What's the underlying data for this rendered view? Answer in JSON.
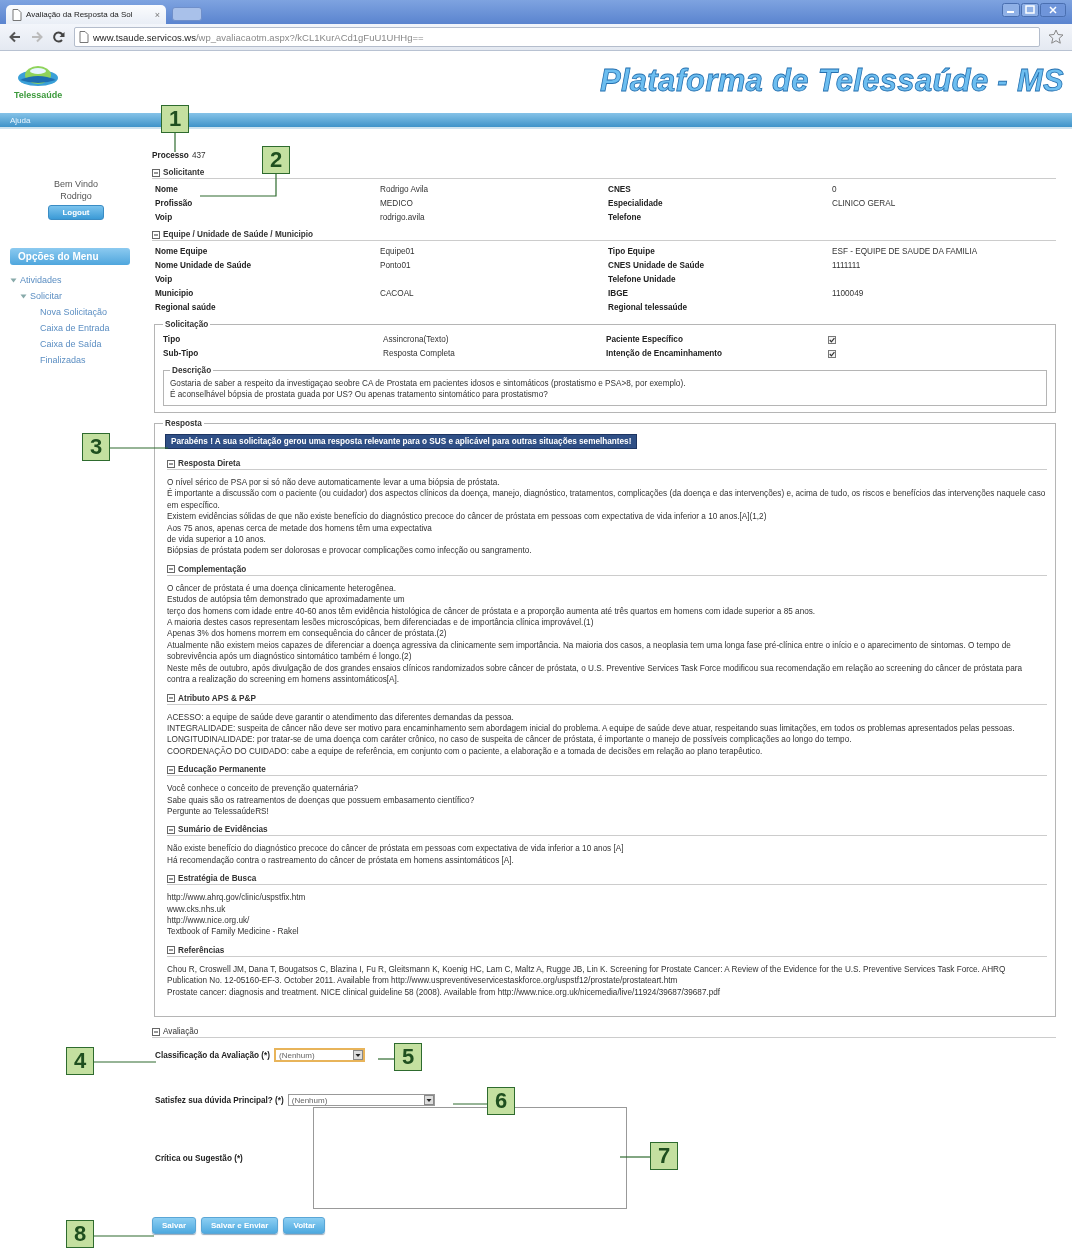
{
  "browser": {
    "tab_title": "Avaliação da Resposta da Sol",
    "tab_close": "×",
    "url_host": "www.tsaude.servicos.ws",
    "url_path": "/wp_avaliacaotm.aspx?/kCL1KurACd1gFuU1UHHg=="
  },
  "header": {
    "logo_text": "Telessaúde",
    "title": "Plataforma de Telessaúde - MS"
  },
  "menu_bar": {
    "label": "Ajuda"
  },
  "sidebar": {
    "welcome": "Bem Vindo",
    "user": "Rodrigo",
    "logout": "Logout",
    "menu_title": "Opções do Menu",
    "tree": [
      {
        "label": "Atividades",
        "expanded": true,
        "children": [
          {
            "label": "Solicitar",
            "expanded": true,
            "children": [
              {
                "label": "Nova Solicitação"
              },
              {
                "label": "Caixa de Entrada"
              },
              {
                "label": "Caixa de Saída"
              },
              {
                "label": "Finalizadas"
              }
            ]
          }
        ]
      }
    ]
  },
  "process": {
    "label": "Processo",
    "value": "437"
  },
  "sections": [
    {
      "title": "Solicitante",
      "expanded": true,
      "fields": [
        {
          "label": "Nome",
          "value": "Rodrigo Avila"
        },
        {
          "label": "CNES",
          "value": "0"
        },
        {
          "label": "Profissão",
          "value": "MEDICO"
        },
        {
          "label": "Especialidade",
          "value": "CLINICO GERAL"
        },
        {
          "label": "Voip",
          "value": "rodrigo.avila"
        },
        {
          "label": "Telefone"
        }
      ]
    },
    {
      "title": "Equipe / Unidade de Saúde / Municipio",
      "expanded": true,
      "fields": [
        {
          "label": "Nome Equipe",
          "value": "Equipe01"
        },
        {
          "label": "Tipo Equipe",
          "value": "ESF - EQUIPE DE SAUDE DA FAMILIA"
        },
        {
          "label": "Nome Unidade de Saúde",
          "value": "Ponto01"
        },
        {
          "label": "CNES Unidade de Saúde",
          "value": "1111111"
        },
        {
          "label": "Voip"
        },
        {
          "label": "Telefone Unidade"
        },
        {
          "label": "Municipio",
          "value": "CACOAL"
        },
        {
          "label": "IBGE",
          "value": "1100049"
        },
        {
          "label": "Regional saúde"
        },
        {
          "label": "Regional telessaúde"
        }
      ]
    }
  ],
  "solicitacao": {
    "legend": "Solicitação",
    "fields": [
      {
        "kind": "text",
        "label": "Tipo",
        "value": "Assincrona(Texto)"
      },
      {
        "kind": "checkbox",
        "label": "Paciente Específico",
        "checked": true
      },
      {
        "kind": "text",
        "label": "Sub-Tipo",
        "value": "Resposta Completa"
      },
      {
        "kind": "checkbox",
        "label": "Intenção de Encaminhamento",
        "checked": true
      }
    ],
    "descricao": {
      "legend": "Descrição",
      "lines": [
        "Gostaria de saber a respeito da investigaçao seobre CA de Prostata em pacientes idosos e sintomáticos (prostatismo e PSA>8, por exemplo).",
        "É aconselhável bópsia de prostata guada por US? Ou apenas tratamento sintomático para prostatismo?"
      ]
    }
  },
  "resposta": {
    "legend": "Resposta",
    "banner": "Parabéns ! A sua solicitação gerou uma resposta relevante para o SUS e aplicável para outras situações semelhantes!",
    "sections": [
      {
        "title": "Resposta Direta",
        "expanded": true,
        "lines": [
          "O nível sérico de PSA por si só não deve automaticamente levar a uma biópsia de próstata.",
          "É importante a discussão com o paciente (ou cuidador) dos aspectos clínicos da doença, manejo, diagnóstico, tratamentos, complicações (da doença e das intervenções) e, acima de tudo, os riscos e benefícios das intervenções naquele caso em específico.",
          "Existem evidências sólidas de que não existe benefício do diagnóstico precoce do câncer de próstata em pessoas com expectativa de vida inferior a 10 anos.[A](1,2)",
          "Aos 75 anos, apenas cerca de metade dos homens têm uma expectativa",
          "de vida superior a 10 anos.",
          "Biópsias de próstata podem ser dolorosas e provocar complicações como infecção ou sangramento."
        ]
      },
      {
        "title": "Complementação",
        "expanded": true,
        "lines": [
          "O câncer de próstata é uma doença clinicamente heterogênea.",
          "Estudos de autópsia têm demonstrado que aproximadamente um",
          "terço dos homens com idade entre 40-60 anos têm evidência histológica de câncer de próstata e a proporção aumenta até três quartos em homens com idade superior a 85 anos.",
          "A maioria destes casos representam lesões microscópicas, bem diferenciadas e de importância clínica improvável.(1)",
          "Apenas 3% dos homens morrem em consequência do câncer de próstata.(2)",
          "Atualmente não existem meios capazes de diferenciar a doença agressiva da clinicamente sem importância. Na maioria dos casos, a neoplasia tem uma longa fase pré-clínica entre o início e o aparecimento de sintomas. O tempo de sobrevivência após um diagnóstico sintomático também é longo.(2)",
          "Neste mês de outubro, após divulgação de dos grandes ensaios clínicos randomizados sobre câncer de próstata, o U.S. Preventive Services Task Force modificou sua recomendação em relação ao screening do câncer de próstata para contra a realização do screening em homens assintomáticos[A]."
        ]
      },
      {
        "title": "Atributo APS & P&P",
        "expanded": true,
        "lines": [
          "ACESSO: a equipe de saúde deve garantir o atendimento das diferentes demandas da pessoa.",
          "INTEGRALIDADE: suspeita de câncer não deve ser motivo para encaminhamento sem abordagem inicial do problema. A equipe de saúde deve atuar, respeitando suas limitações, em todos os problemas apresentados pelas pessoas.",
          "LONGITUDINALIDADE: por tratar-se de uma doença com caráter crônico, no caso de suspeita de câncer de próstata, é importante o manejo de possíveis complicações ao longo do tempo.",
          "COORDENAÇÃO DO CUIDADO: cabe a equipe de referência, em conjunto com o paciente, a elaboração e a tomada de decisões em relação ao plano terapêutico."
        ]
      },
      {
        "title": "Educação Permanente",
        "expanded": true,
        "lines": [
          "Você conhece o conceito de prevenção quaternária?",
          "Sabe quais são os ratreamentos de doenças que possuem embasamento científico?",
          "Pergunte ao TelessaúdeRS!"
        ]
      },
      {
        "title": "Sumário de Evidências",
        "expanded": true,
        "lines": [
          "Não existe benefício do diagnóstico precoce do câncer de próstata em pessoas com expectativa de vida inferior a 10 anos [A]",
          "Há recomendação contra o rastreamento do câncer de próstata em homens assintomáticos [A]."
        ]
      },
      {
        "title": "Estratégia de Busca",
        "expanded": true,
        "lines": [
          "http://www.ahrq.gov/clinic/uspstfix.htm",
          "www.cks.nhs.uk",
          "http://www.nice.org.uk/",
          "Textbook of Family Medicine - Rakel"
        ]
      },
      {
        "title": "Referências",
        "expanded": true,
        "lines": [
          "Chou R, Croswell JM, Dana T, Bougatsos C, Blazina I, Fu R, Gleitsmann K, Koenig HC, Lam C, Maltz A, Rugge JB, Lin K. Screening for Prostate Cancer: A Review of the Evidence for the U.S. Preventive Services Task Force. AHRQ Publication No. 12-05160-EF-3. October 2011. Available from http://www.uspreventiveservicestaskforce.org/uspstf12/prostate/prostateart.htm",
          "Prostate cancer: diagnosis and treatment. NICE clinical guideline 58 (2008). Available from http://www.nice.org.uk/nicemedia/live/11924/39687/39687.pdf"
        ]
      }
    ]
  },
  "avaliacao": {
    "title": "Avaliação",
    "expanded": true,
    "fields": [
      {
        "kind": "select",
        "label": "Classificação da Avaliação (*)",
        "value": "(Nenhum)",
        "focused": true
      },
      {
        "kind": "select",
        "label": "Satisfez sua dúvida Principal? (*)",
        "value": "(Nenhum)",
        "focused": false
      },
      {
        "kind": "textarea",
        "label": "Crítica ou Sugestão (*)"
      }
    ],
    "buttons": [
      "Salvar",
      "Salvar e Enviar",
      "Voltar"
    ]
  },
  "callouts": [
    {
      "number": "1"
    },
    {
      "number": "2"
    },
    {
      "number": "3"
    },
    {
      "number": "4"
    },
    {
      "number": "5"
    },
    {
      "number": "6"
    },
    {
      "number": "7"
    },
    {
      "number": "8"
    }
  ]
}
